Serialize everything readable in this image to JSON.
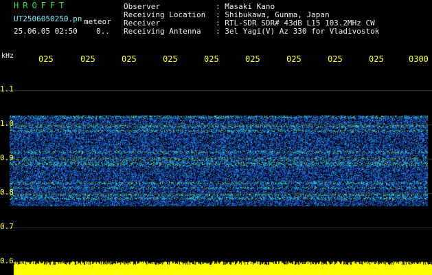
{
  "header": {
    "app_title": "HROFFT",
    "file_name": "UT2506050250.pn",
    "meteor_label": "meteor",
    "timestamp": "25.06.05 02:50",
    "status_mark": "0..",
    "fields": [
      {
        "label": "Observer",
        "value": ": Masaki Kano"
      },
      {
        "label": "Receiving Location",
        "value": ": Shibukawa, Gunma, Japan"
      },
      {
        "label": "Receiver",
        "value": ": RTL-SDR SDR# 43dB L15 103.2MHz CW"
      },
      {
        "label": "Receiving Antenna",
        "value": ": 3el Yagi(V) Az 330 for Vladivostok"
      }
    ]
  },
  "axes": {
    "freq_unit": "kHz",
    "freq_ticks": [
      "1.1",
      "1.0",
      "0.9",
      "0.8",
      "0.7",
      "0.6"
    ],
    "time_ticks": [
      "025",
      "025",
      "025",
      "025",
      "025",
      "025",
      "025",
      "025",
      "025",
      "0300"
    ]
  },
  "colors": {
    "background": "#000000",
    "grid": "#888888",
    "text_green": "#33dd33",
    "text_cyan": "#7ff0ff",
    "text_yellow": "#ffff33",
    "power_bar": "#ffff00"
  }
}
